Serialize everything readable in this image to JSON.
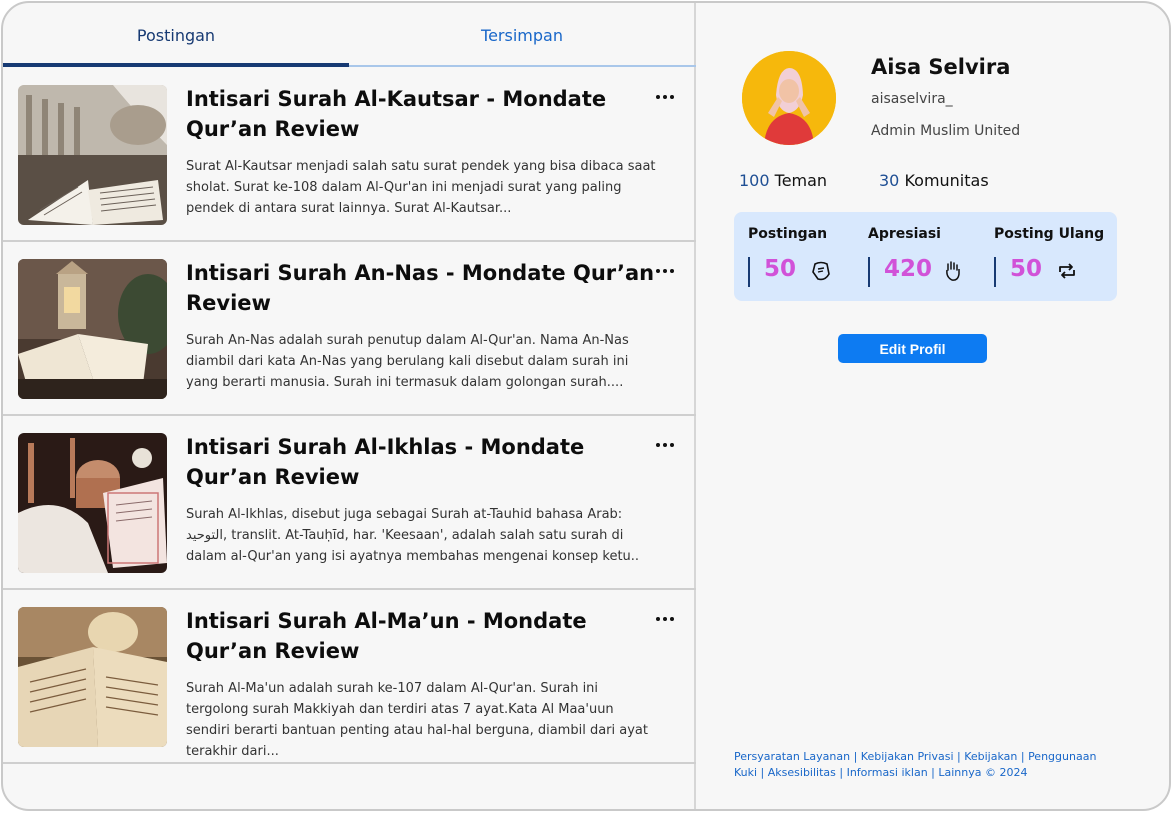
{
  "tabs": [
    {
      "label": "Postingan",
      "active": true
    },
    {
      "label": "Tersimpan",
      "active": false
    }
  ],
  "posts": [
    {
      "title": "Intisari Surah Al-Kautsar - Mondate Qur’an Review",
      "excerpt": "Surat Al-Kautsar menjadi salah satu surat pendek yang bisa dibaca saat sholat. Surat ke-108 dalam Al-Qur'an ini menjadi surat yang paling pendek di antara surat lainnya. Surat Al-Kautsar...",
      "image": "mosque-quran-photo"
    },
    {
      "title": "Intisari Surah An-Nas - Mondate Qur’an Review",
      "excerpt": "Surah An-Nas adalah surah penutup dalam Al-Qur'an. Nama An-Nas diambil dari kata An-Nas yang berulang kali disebut dalam surah ini yang berarti manusia. Surah ini termasuk dalam golongan surah....",
      "image": "lantern-quran-photo"
    },
    {
      "title": "Intisari Surah Al-Ikhlas - Mondate Qur’an Review",
      "excerpt": "Surah Al-Ikhlas, disebut juga sebagai Surah at-Tauhid bahasa Arab: التوحيد, translit. At-Tauḥīd, har. 'Keesaan', adalah salah satu surah di dalam al-Qur'an yang isi ayatnya membahas mengenai konsep ketu..",
      "image": "night-mosque-quran-photo"
    },
    {
      "title": "Intisari Surah Al-Ma’un - Mondate Qur’an Review",
      "excerpt": "Surah Al-Ma'un adalah surah ke-107 dalam Al-Qur'an. Surah ini tergolong surah Makkiyah dan terdiri atas 7 ayat.Kata Al Maa'uun sendiri berarti bantuan penting atau hal-hal berguna, diambil dari ayat terakhir dari...",
      "image": "open-quran-photo"
    }
  ],
  "profile": {
    "name": "Aisa Selvira",
    "username": "aisaselvira_",
    "role": "Admin Muslim United",
    "friends_count": "100",
    "friends_label": "Teman",
    "communities_count": "30",
    "communities_label": "Komunitas"
  },
  "stats": [
    {
      "label": "Postingan",
      "value": "50",
      "icon": "post-icon"
    },
    {
      "label": "Apresiasi",
      "value": "420",
      "icon": "clap-icon"
    },
    {
      "label": "Posting Ulang",
      "value": "50",
      "icon": "repost-icon"
    }
  ],
  "edit_button": "Edit Profil",
  "footer": {
    "line1": "Persyaratan Layanan | Kebijakan Privasi | Kebijakan | Penggunaan",
    "line2": "Kuki | Aksesibilitas | Informasi iklan | Lainnya © 2024"
  },
  "colors": {
    "accent": "#0d7bf2",
    "tab_active": "#173a73",
    "stat_value": "#d152d8",
    "stats_bg": "#d8e8fd"
  }
}
